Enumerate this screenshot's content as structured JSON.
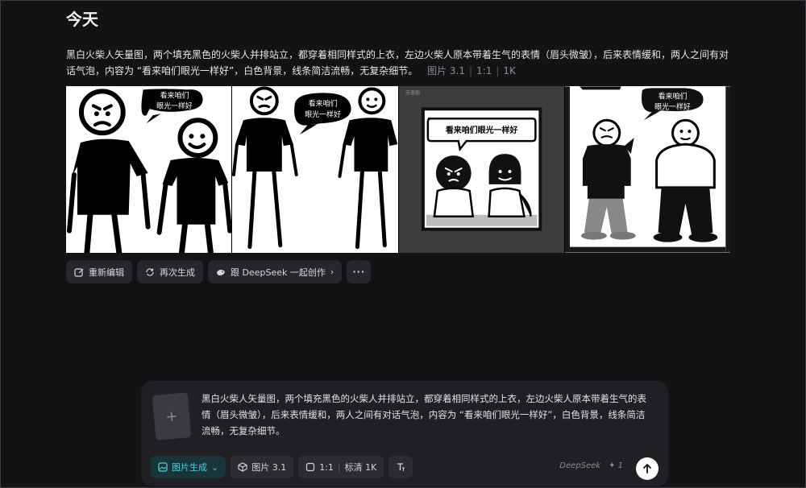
{
  "day_title": "今天",
  "prompt": {
    "text": "黑白火柴人矢量图，两个填充黑色的火柴人并排站立，都穿着相同样式的上衣，左边火柴人原本带着生气的表情（眉头微皱），后来表情缓和，两人之间有对话气泡，内容为 “看来咱们眼光一样好”，白色背景，线条简洁流畅，无复杂细节。",
    "model": "图片 3.1",
    "ratio": "1:1",
    "quality": "1K"
  },
  "images": {
    "bubble_line1": "看来咱们",
    "bubble_line2": "眼光一样好",
    "bubble_full": "看来咱们眼光一样好",
    "tag": "示意图"
  },
  "actions": {
    "reedit": "重新编辑",
    "regenerate": "再次生成",
    "create": "跟 DeepSeek 一起创作",
    "more": "···"
  },
  "composer": {
    "text": "黑白火柴人矢量图，两个填充黑色的火柴人并排站立，都穿着相同样式的上衣，左边火柴人原本带着生气的表情（眉头微皱），后来表情缓和，两人之间有对话气泡，内容为 “看来咱们眼光一样好”，白色背景，线条简洁流畅，无复杂细节。",
    "mode": "图片生成",
    "model": "图片 3.1",
    "ratio": "1:1",
    "quality": "标清 1K",
    "brand": "DeepSeek",
    "credits": "1"
  },
  "colors": {
    "accent": "#4fd0d8",
    "background": "#131316",
    "panel": "#202024"
  }
}
